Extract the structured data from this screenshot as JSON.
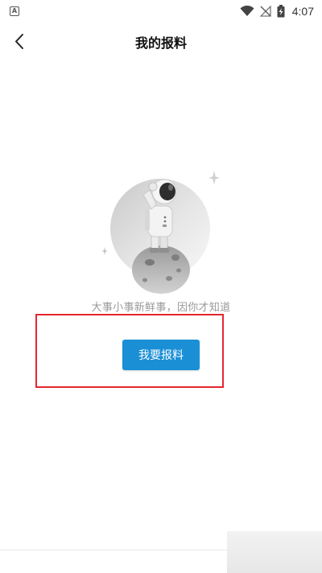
{
  "status_bar": {
    "app_icon_letter": "A",
    "time": "4:07"
  },
  "header": {
    "title": "我的报料"
  },
  "empty_state": {
    "message": "大事小事新鲜事，因你才知道"
  },
  "actions": {
    "report_button_label": "我要报料"
  },
  "colors": {
    "primary_button": "#1a8fd6",
    "highlight_border": "#e5272d",
    "hint_text": "#9a9a9a"
  },
  "icons": {
    "back": "chevron-left-icon",
    "wifi": "wifi-icon",
    "signal": "no-signal-icon",
    "battery": "battery-charging-icon"
  }
}
